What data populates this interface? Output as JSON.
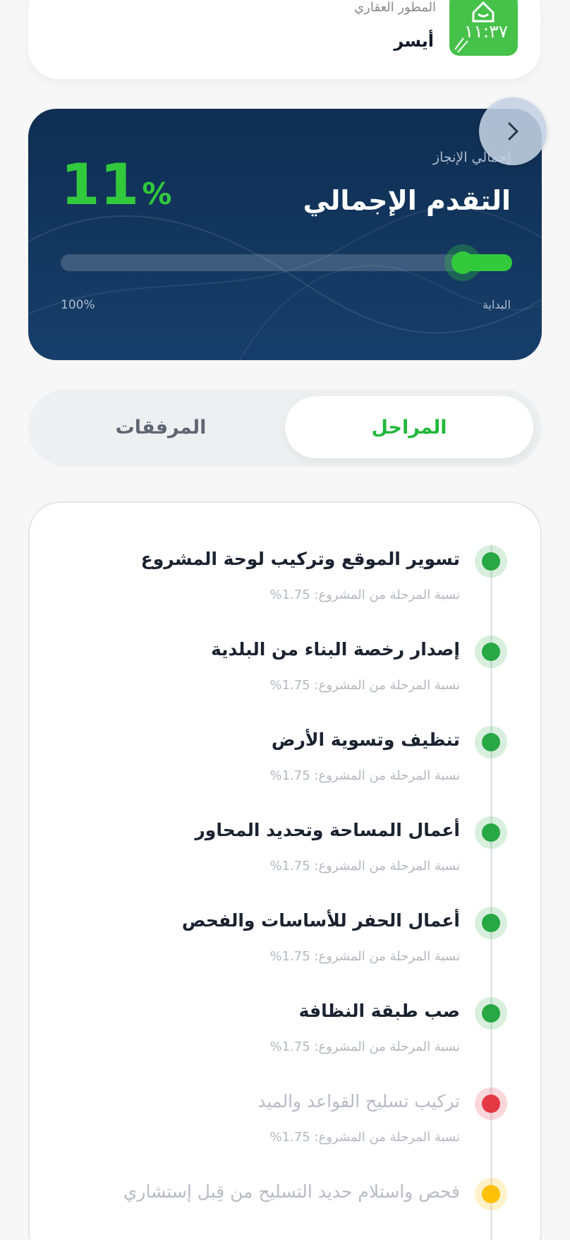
{
  "developer": {
    "role": "المطور العقاري",
    "name": "أيسر",
    "logo_text": "١١:٣٧",
    "logo_color": "#46c24a"
  },
  "progress": {
    "label": "إجمالي الإنجاز",
    "title": "التقدم الإجمالي",
    "value": "11",
    "percent_sign": "%",
    "fraction": 0.11,
    "start_label": "البداية",
    "end_label": "100%",
    "next_icon": "chevron-right-icon"
  },
  "tabs": {
    "active": "المراحل",
    "inactive": "المرفقات"
  },
  "phases": [
    {
      "title": "تسوير الموقع وتركيب لوحة المشروع",
      "share": "نسبة المرحلة من المشروع: 1.75%",
      "status": "done"
    },
    {
      "title": "إصدار رخصة البناء من البلدية",
      "share": "نسبة المرحلة من المشروع: 1.75%",
      "status": "done"
    },
    {
      "title": "تنظيف وتسوية الأرض",
      "share": "نسبة المرحلة من المشروع: 1.75%",
      "status": "done"
    },
    {
      "title": "أعمال المساحة وتحديد المحاور",
      "share": "نسبة المرحلة من المشروع: 1.75%",
      "status": "done"
    },
    {
      "title": "أعمال الحفر للأساسات والفحص",
      "share": "نسبة المرحلة من المشروع: 1.75%",
      "status": "done"
    },
    {
      "title": "صب طبقة النظافة",
      "share": "نسبة المرحلة من المشروع: 1.75%",
      "status": "done"
    },
    {
      "title": "تركيب تسليح القواعد والميد",
      "share": "نسبة المرحلة من المشروع: 1.75%",
      "status": "late"
    },
    {
      "title": "فحص واستلام حديد التسليح من قِبل إستشاري",
      "share": "",
      "status": "pending"
    }
  ],
  "colors": {
    "accent_green": "#32c93d",
    "card_navy": "#0f2e52",
    "done": "#28a745",
    "late": "#e53946",
    "pending": "#ffc107"
  }
}
